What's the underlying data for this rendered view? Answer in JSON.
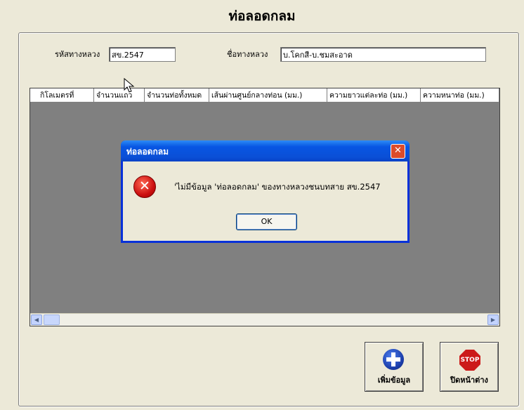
{
  "form": {
    "title": "ท่อลอดกลม",
    "road_code_label": "รหัสทางหลวง",
    "road_code_value": "สข.2547",
    "road_name_label": "ชื่อทางหลวง",
    "road_name_value": "บ.โคกสี-บ.ชมสะอาด"
  },
  "grid": {
    "columns": [
      "กิโลเมตรที่",
      "จำนวนแถว",
      "จำนวนท่อทั้งหมด",
      "เส้นผ่านศูนย์กลางท่อน (มม.)",
      "ความยาวแต่ละท่อ (มม.)",
      "ความหนาท่อ (มม.)"
    ],
    "rows": []
  },
  "dialog": {
    "title": "ท่อลอดกลม",
    "message": "'ไม่มีข้อมูล 'ท่อลอดกลม'  ของทางหลวงชนบทสาย  สข.2547",
    "ok_label": "OK",
    "close_glyph": "✕",
    "icon": "error-icon"
  },
  "buttons": {
    "add_label": "เพิ่มข้อมูล",
    "close_label": "ปิดหน้าต่าง",
    "stop_glyph": "STOP"
  },
  "colors": {
    "window_bg": "#ECE9D8",
    "grid_bg": "#808080",
    "title_bar": "#0A4FD6",
    "close_button": "#DC4C2B"
  }
}
